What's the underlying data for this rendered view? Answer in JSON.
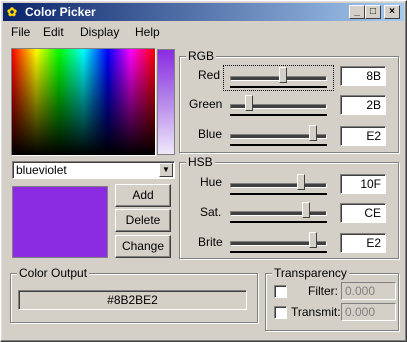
{
  "window": {
    "title": "Color Picker",
    "min": "_",
    "max": "□",
    "close": "×"
  },
  "menu": [
    {
      "label": "File"
    },
    {
      "label": "Edit"
    },
    {
      "label": "Display"
    },
    {
      "label": "Help"
    }
  ],
  "picker": {
    "color_name": "blueviolet",
    "swatch_color": "#8b2be2"
  },
  "actions": {
    "add": "Add",
    "delete": "Delete",
    "change": "Change"
  },
  "rgb": {
    "label": "RGB",
    "red": {
      "label": "Red",
      "value": "8B",
      "level": 0.545
    },
    "green": {
      "label": "Green",
      "value": "2B",
      "level": 0.169
    },
    "blue": {
      "label": "Blue",
      "value": "E2",
      "level": 0.886
    }
  },
  "hsb": {
    "label": "HSB",
    "hue": {
      "label": "Hue",
      "value": "10F",
      "level": 0.75
    },
    "sat": {
      "label": "Sat.",
      "value": "CE",
      "level": 0.81
    },
    "brite": {
      "label": "Brite",
      "value": "E2",
      "level": 0.886
    }
  },
  "output": {
    "label": "Color Output",
    "value": "#8B2BE2"
  },
  "transparency": {
    "label": "Transparency",
    "filter": {
      "label": "Filter:",
      "value": "0.000",
      "checked": false
    },
    "transmit": {
      "label": "Transmit:",
      "value": "0.000",
      "checked": false
    }
  }
}
